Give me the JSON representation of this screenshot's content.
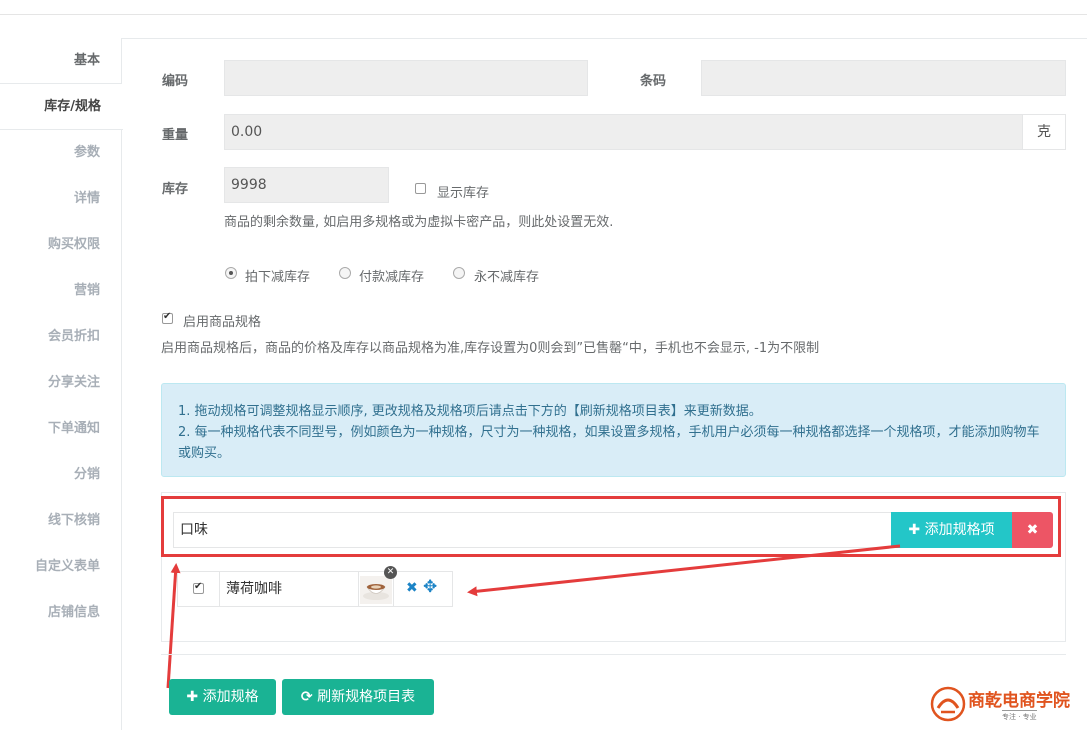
{
  "sidebar": {
    "items": [
      {
        "label": "基本"
      },
      {
        "label": "库存/规格"
      },
      {
        "label": "参数"
      },
      {
        "label": "详情"
      },
      {
        "label": "购买权限"
      },
      {
        "label": "营销"
      },
      {
        "label": "会员折扣"
      },
      {
        "label": "分享关注"
      },
      {
        "label": "下单通知"
      },
      {
        "label": "分销"
      },
      {
        "label": "线下核销"
      },
      {
        "label": "自定义表单"
      },
      {
        "label": "店铺信息"
      }
    ]
  },
  "form": {
    "code_label": "编码",
    "code_value": "",
    "barcode_label": "条码",
    "barcode_value": "",
    "weight_label": "重量",
    "weight_value": "0.00",
    "weight_unit": "克",
    "stock_label": "库存",
    "stock_value": "9998",
    "show_stock_label": "显示库存",
    "show_stock_checked": false,
    "stock_help": "商品的剩余数量, 如启用多规格或为虚拟卡密产品，则此处设置无效.",
    "deduct_options": [
      {
        "label": "拍下减库存",
        "checked": true
      },
      {
        "label": "付款减库存",
        "checked": false
      },
      {
        "label": "永不减库存",
        "checked": false
      }
    ],
    "enable_spec_label": "启用商品规格",
    "enable_spec_checked": true,
    "enable_spec_help": "启用商品规格后，商品的价格及库存以商品规格为准,库存设置为0则会到”已售罄“中，手机也不会显示, -1为不限制"
  },
  "alert": {
    "line1": "1. 拖动规格可调整规格显示顺序, 更改规格及规格项后请点击下方的【刷新规格项目表】来更新数据。",
    "line2": "2. 每一种规格代表不同型号，例如颜色为一种规格，尺寸为一种规格，如果设置多规格，手机用户必须每一种规格都选择一个规格项，才能添加购物车或购买。"
  },
  "spec": {
    "name_value": "口味",
    "add_item_label": "添加规格项",
    "delete_icon": "times-icon",
    "items": [
      {
        "label": "薄荷咖啡",
        "checked": true
      }
    ]
  },
  "buttons": {
    "add_spec_label": "添加规格",
    "refresh_label": "刷新规格项目表"
  },
  "watermark": {
    "title": "商乾电商学院",
    "subtitle": "专注 · 专业"
  },
  "colors": {
    "primary": "#1ab394",
    "info": "#23c6c8",
    "danger": "#ed5565",
    "alert_bg": "#d9edf7",
    "highlight": "#e43c3c"
  }
}
